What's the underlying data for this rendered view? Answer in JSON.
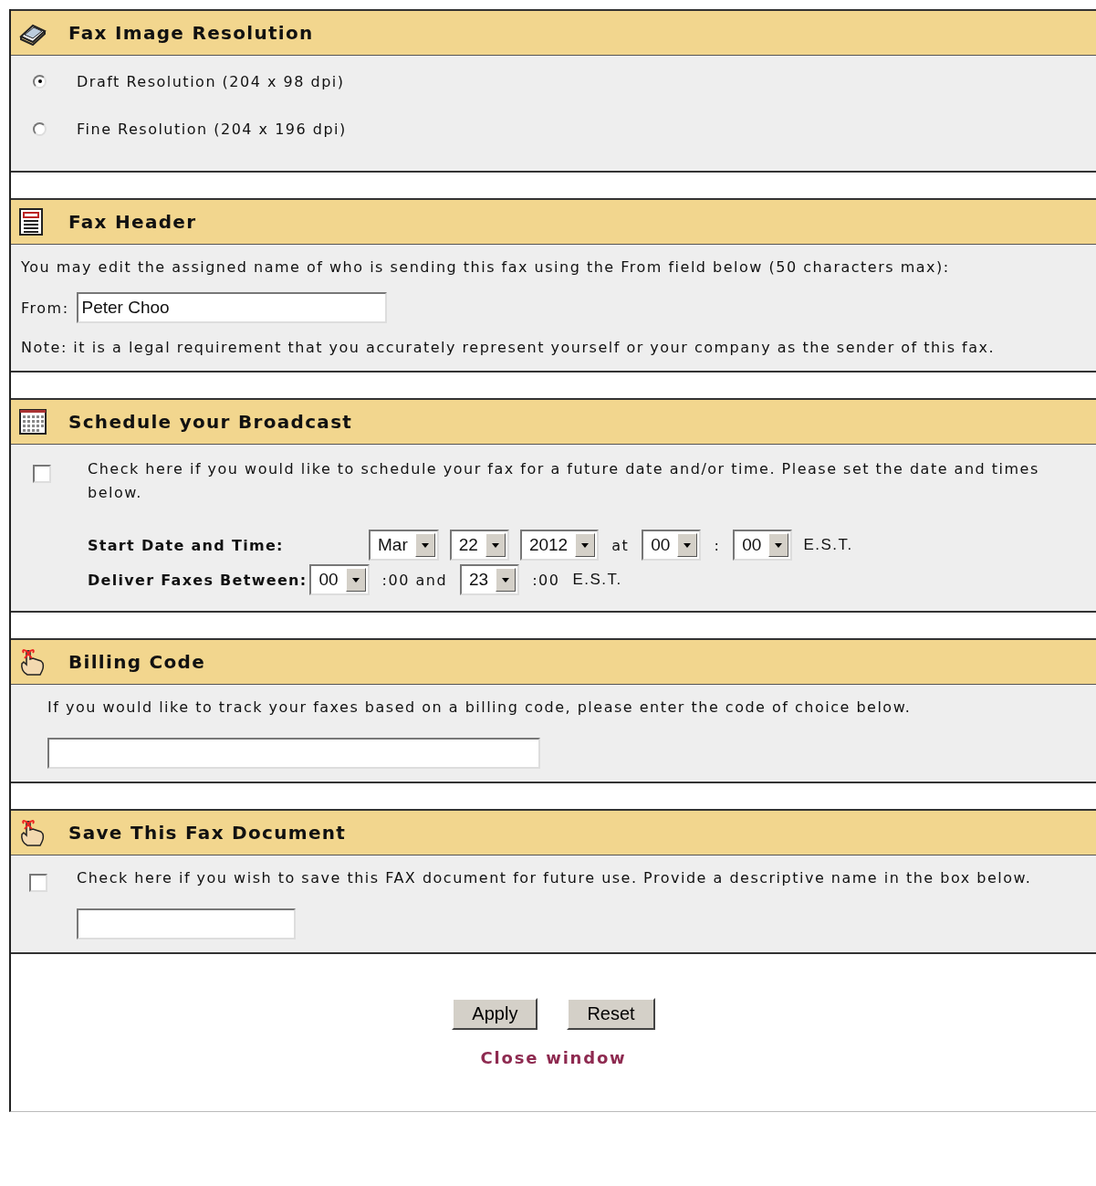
{
  "sections": [
    {
      "kind": "resolution",
      "title": "Fax Image Resolution",
      "options": [
        {
          "label": "Draft Resolution (204 x 98 dpi)",
          "selected": true
        },
        {
          "label": "Fine Resolution (204 x 196 dpi)",
          "selected": false
        }
      ]
    },
    {
      "kind": "header",
      "title": "Fax Header",
      "intro": "You may edit the assigned name of who is sending this fax using the From field below (50 characters max):",
      "from_label": "From:",
      "from_value": "Peter Choo",
      "note": "Note: it is a legal requirement that you accurately represent yourself or your company as the sender of this fax."
    },
    {
      "kind": "schedule",
      "title": "Schedule your Broadcast",
      "checked": false,
      "text": "Check here if you would like to schedule your fax for a future date and/or time. Please set the date and times below.",
      "rows": [
        {
          "label": "Start Date and Time:",
          "items": [
            {
              "kind": "select",
              "value": "Mar"
            },
            {
              "kind": "select",
              "value": "22"
            },
            {
              "kind": "select",
              "value": "2012"
            },
            {
              "kind": "text",
              "text": "at"
            },
            {
              "kind": "select",
              "value": "00"
            },
            {
              "kind": "text",
              "text": ":"
            },
            {
              "kind": "select",
              "value": "00"
            },
            {
              "kind": "tz",
              "text": "E.S.T."
            }
          ]
        },
        {
          "label": "Deliver Faxes Between:",
          "items": [
            {
              "kind": "select",
              "value": "00"
            },
            {
              "kind": "text",
              "text": ":00 and"
            },
            {
              "kind": "select",
              "value": "23"
            },
            {
              "kind": "text",
              "text": ":00"
            },
            {
              "kind": "tz",
              "text": "E.S.T."
            }
          ]
        }
      ]
    },
    {
      "kind": "billing",
      "title": "Billing Code",
      "text": "If you would like to track your faxes based on a billing code, please enter the code of choice below."
    },
    {
      "kind": "save",
      "title": "Save This Fax Document",
      "checked": false,
      "text": "Check here if you wish to save this FAX document for future use. Provide a descriptive name in the box below."
    }
  ],
  "buttons": [
    "Apply",
    "Reset"
  ],
  "close_link": "Close window"
}
